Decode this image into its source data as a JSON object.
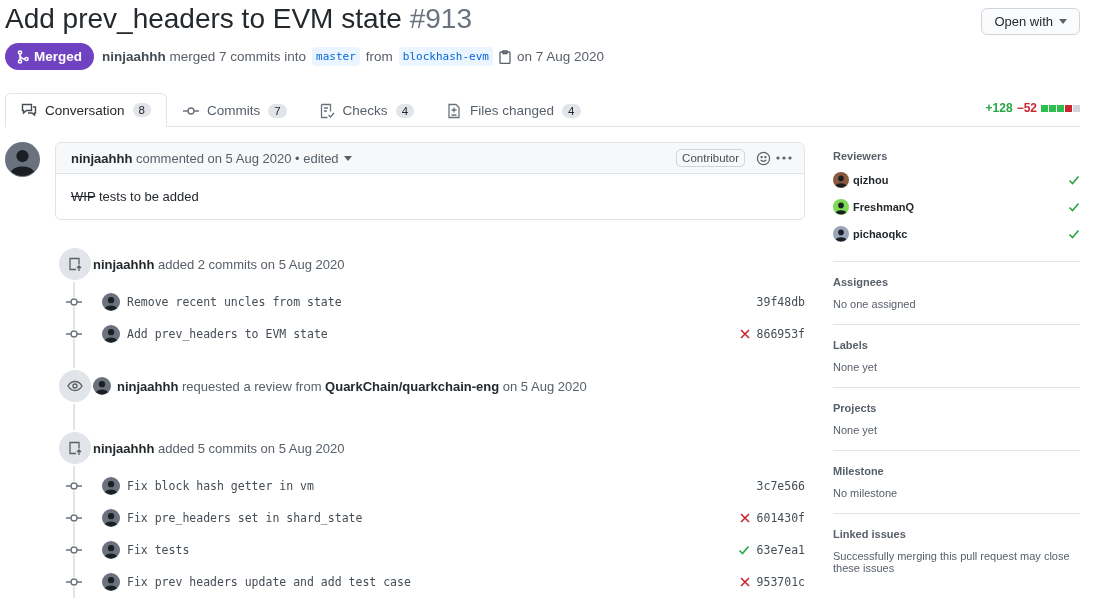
{
  "title": {
    "text": "Add prev_headers to EVM state",
    "number": "#913"
  },
  "open_with": "Open with",
  "status": {
    "label": "Merged",
    "summary": "**ninjaahhh** merged 7 commits into",
    "base": "master",
    "from": "from",
    "head": "blockhash-evm",
    "date": "on 7 Aug 2020"
  },
  "tabs": [
    {
      "label": "Conversation",
      "count": "8",
      "selected": true
    },
    {
      "label": "Commits",
      "count": "7",
      "selected": false
    },
    {
      "label": "Checks",
      "count": "4",
      "selected": false
    },
    {
      "label": "Files changed",
      "count": "4",
      "selected": false
    }
  ],
  "diffstat": {
    "added": "+128",
    "removed": "−52",
    "blocks": [
      {
        "kind": "added"
      },
      {
        "kind": "added"
      },
      {
        "kind": "added"
      },
      {
        "kind": "removed"
      },
      {
        "kind": "neutral"
      }
    ]
  },
  "comment": {
    "author": "ninjaahhh",
    "meta": "commented on 5 Aug 2020 • edited",
    "badge": "Contributor",
    "struck": "WIP",
    "body": "tests to be added"
  },
  "events": [
    {
      "kind": "commits",
      "text": "**ninjaahhh** added 2 commits on 5 Aug 2020",
      "commits": [
        {
          "message": "Remove recent uncles from state",
          "sha": "39f48db",
          "kind": "none"
        },
        {
          "message": "Add prev_headers to EVM state",
          "sha": "866953f",
          "kind": "failure"
        }
      ]
    },
    {
      "kind": "review",
      "text": "**ninjaahhh** requested a review from **QuarkChain/quarkchain-eng** on 5 Aug 2020"
    },
    {
      "kind": "commits",
      "text": "**ninjaahhh** added 5 commits on 5 Aug 2020",
      "commits": [
        {
          "message": "Fix block hash getter in vm",
          "sha": "3c7e566",
          "kind": "none"
        },
        {
          "message": "Fix pre_headers set in shard_state",
          "sha": "601430f",
          "kind": "failure"
        },
        {
          "message": "Fix tests",
          "sha": "63e7ea1",
          "kind": "success"
        },
        {
          "message": "Fix prev headers update and add test case",
          "sha": "953701c",
          "kind": "failure"
        }
      ]
    }
  ],
  "sidebar": [
    {
      "heading": "Reviewers",
      "reviewers": [
        {
          "name": "qizhou",
          "approved": true
        },
        {
          "name": "FreshmanQ",
          "approved": true
        },
        {
          "name": "pichaoqkc",
          "approved": true
        }
      ]
    },
    {
      "heading": "Assignees",
      "text": "No one assigned"
    },
    {
      "heading": "Labels",
      "text": "None yet"
    },
    {
      "heading": "Projects",
      "text": "None yet"
    },
    {
      "heading": "Milestone",
      "text": "No milestone"
    },
    {
      "heading": "Linked issues",
      "text": "Successfully merging this pull request may close these issues"
    }
  ]
}
